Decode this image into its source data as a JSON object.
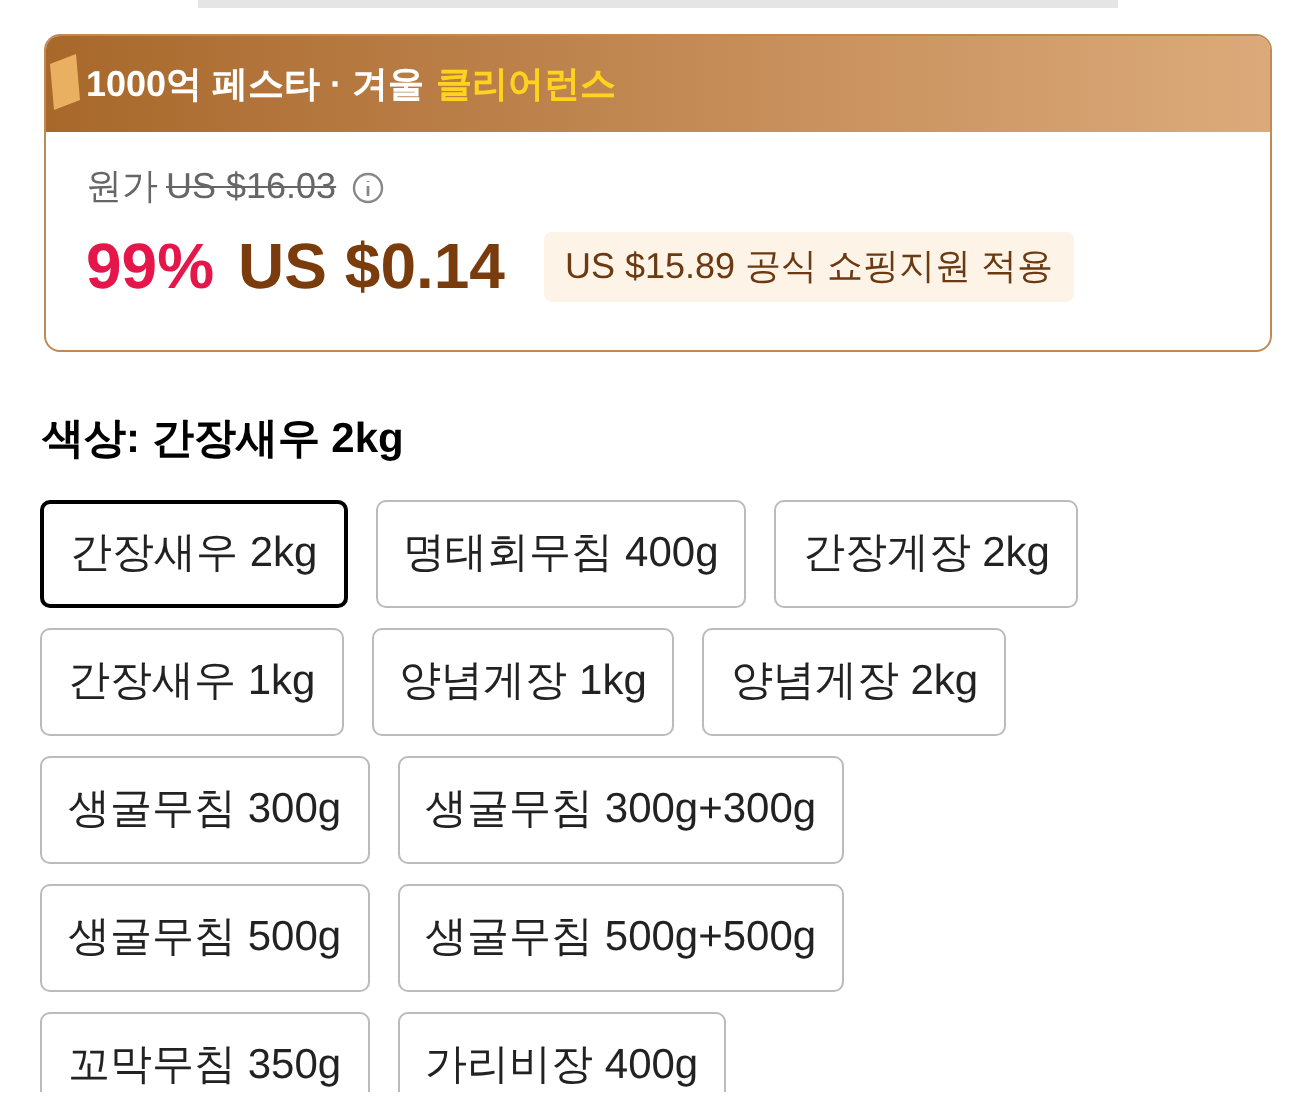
{
  "promo": {
    "title": "1000억 페스타 · 겨울",
    "highlight": "클리어런스"
  },
  "price": {
    "original_label": "원가",
    "original_price": "US $16.03",
    "discount": "99%",
    "price": "US $0.14",
    "subsidy": "US $15.89 공식 쇼핑지원 적용"
  },
  "option_label": "색상: 간장새우 2kg",
  "option_rows": [
    [
      {
        "label": "간장새우 2kg",
        "selected": true
      },
      {
        "label": "명태회무침 400g",
        "selected": false
      },
      {
        "label": "간장게장 2kg",
        "selected": false
      }
    ],
    [
      {
        "label": "간장새우 1kg",
        "selected": false
      },
      {
        "label": "양념게장 1kg",
        "selected": false
      },
      {
        "label": "양념게장 2kg",
        "selected": false
      }
    ],
    [
      {
        "label": "생굴무침 300g",
        "selected": false
      },
      {
        "label": "생굴무침 300g+300g",
        "selected": false
      }
    ],
    [
      {
        "label": "생굴무침 500g",
        "selected": false
      },
      {
        "label": "생굴무침 500g+500g",
        "selected": false
      }
    ],
    [
      {
        "label": "꼬막무침 350g",
        "selected": false
      },
      {
        "label": "가리비장 400g",
        "selected": false
      }
    ]
  ]
}
